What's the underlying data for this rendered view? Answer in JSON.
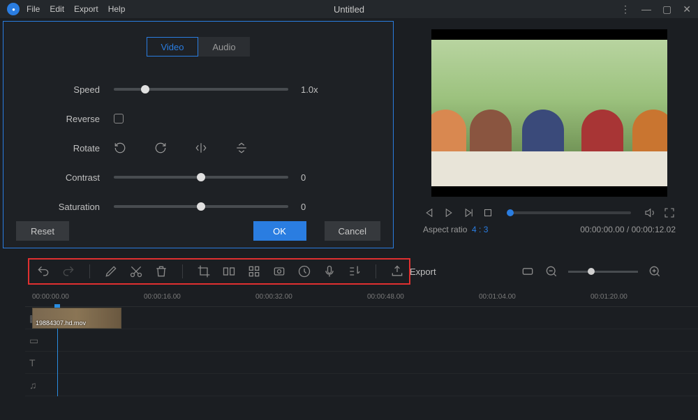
{
  "menu": {
    "file": "File",
    "edit": "Edit",
    "export": "Export",
    "help": "Help"
  },
  "title": "Untitled",
  "dialog": {
    "tab_video": "Video",
    "tab_audio": "Audio",
    "speed_label": "Speed",
    "speed_value": "1.0x",
    "reverse_label": "Reverse",
    "rotate_label": "Rotate",
    "contrast_label": "Contrast",
    "contrast_value": "0",
    "saturation_label": "Saturation",
    "saturation_value": "0",
    "reset": "Reset",
    "ok": "OK",
    "cancel": "Cancel"
  },
  "preview": {
    "aspect_label": "Aspect ratio",
    "aspect_value": "4 : 3",
    "time": "00:00:00.00 / 00:00:12.02"
  },
  "toolbar": {
    "export": "Export"
  },
  "timeline": {
    "marks": [
      "00:00:00.00",
      "00:00:16.00",
      "00:00:32.00",
      "00:00:48.00",
      "00:01:04.00",
      "00:01:20.00"
    ],
    "clip_label": "19884307.hd.mov"
  }
}
